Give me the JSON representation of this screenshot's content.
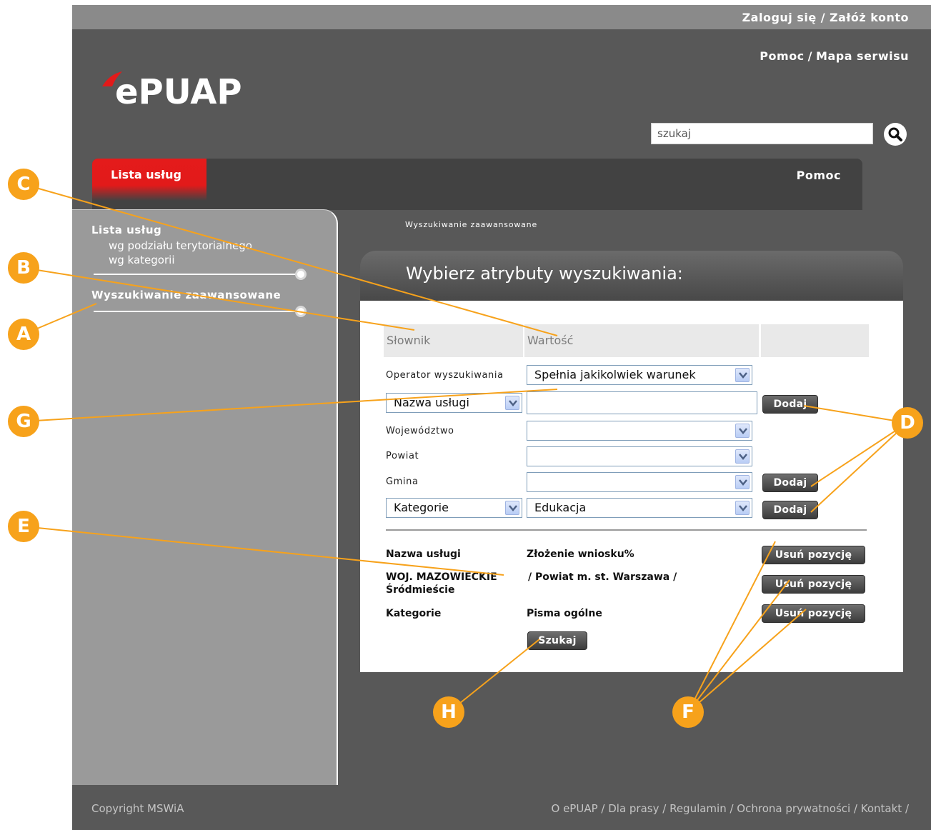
{
  "header": {
    "login_label": "Zaloguj się",
    "register_label": "Załóż konto",
    "help_label": "Pomoc",
    "sitemap_label": "Mapa serwisu",
    "links_separator": "/",
    "logo_text": "ePUAP",
    "search": {
      "value": "szukaj",
      "icon": "search-icon"
    }
  },
  "tabs": {
    "lista": "Lista usług",
    "pomoc": "Pomoc"
  },
  "sidebar": {
    "section1_title": "Lista usług",
    "section1_items": [
      "wg podziału terytorialnego",
      "wg kategorii"
    ],
    "section2_title": "Wyszukiwanie zaawansowane"
  },
  "breadcrumb": "Wyszukiwanie zaawansowane",
  "panel": {
    "title": "Wybierz atrybuty wyszukiwania:",
    "col_dictionary": "Słownik",
    "col_value": "Wartość",
    "operator_label": "Operator wyszukiwania",
    "operator_value": "Spełnia jakikolwiek warunek",
    "dict_select_value": "Nazwa usługi",
    "service_name_value": "",
    "voivodeship_label": "Województwo",
    "county_label": "Powiat",
    "commune_label": "Gmina",
    "category_select_value": "Kategorie",
    "category_value": "Edukacja",
    "add_label": "Dodaj",
    "results": [
      {
        "label": "Nazwa usługi",
        "value": "Złożenie wniosku%"
      },
      {
        "label": "WOJ. MAZOWIECKIE",
        "value": "/ Powiat m. st. Warszawa /",
        "label_line2": "Śródmieście"
      },
      {
        "label": "Kategorie",
        "value": "Pisma ogólne"
      }
    ],
    "remove_label": "Usuń pozycję",
    "search_button": "Szukaj"
  },
  "footer": {
    "copyright": "Copyright MSWiA",
    "links": "O ePUAP / Dla prasy / Regulamin / Ochrona prywatności / Kontakt /"
  },
  "annotations": {
    "A": "A",
    "B": "B",
    "C": "C",
    "D": "D",
    "E": "E",
    "F": "F",
    "G": "G",
    "H": "H"
  },
  "colors": {
    "background": "#585858",
    "accent_red": "#e21a1a",
    "annotation_orange": "#f7a21b",
    "sidebar": "#9a9a9a"
  }
}
